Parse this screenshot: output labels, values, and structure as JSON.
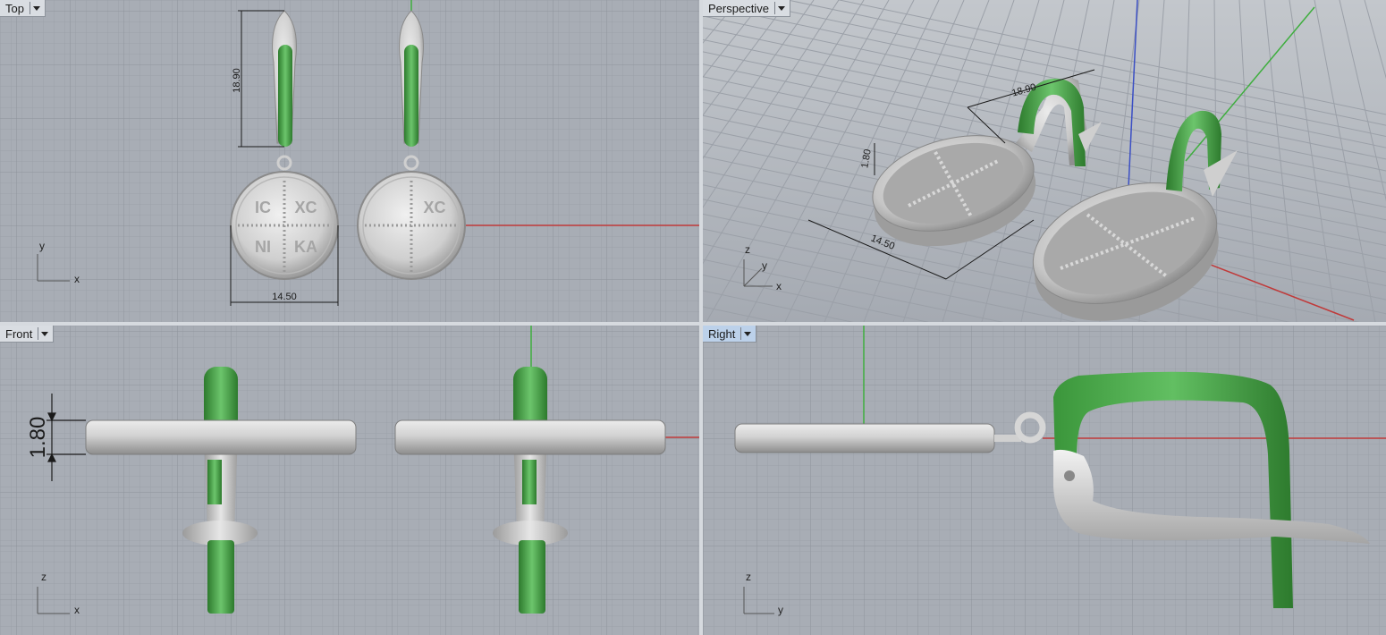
{
  "viewports": {
    "top": {
      "label": "Top",
      "dimensions": {
        "height": "18.90",
        "width": "14.50"
      },
      "medallion_left": {
        "tl": "IC",
        "tr": "XC",
        "bl": "NI",
        "br": "KA"
      },
      "medallion_right": {
        "tr": "XC"
      },
      "axes": {
        "v": "y",
        "h": "x"
      }
    },
    "perspective": {
      "label": "Perspective",
      "dimensions": {
        "height": "18.90",
        "width": "14.50",
        "thickness": "1.80"
      },
      "axes": {
        "v": "z",
        "d": "y",
        "h": "x"
      }
    },
    "front": {
      "label": "Front",
      "dimensions": {
        "thickness": "1.80"
      },
      "axes": {
        "v": "z",
        "h": "x"
      }
    },
    "right": {
      "label": "Right",
      "axes": {
        "v": "z",
        "h": "y"
      }
    }
  },
  "colors": {
    "grid_bg": "#a8adb5",
    "grid_minor": "#9ba1a9",
    "grid_major": "#8e949c",
    "x_axis": "#c03a3a",
    "y_axis": "#3fae3f",
    "z_axis": "#3b4fc4",
    "silver": "#d6d6d6",
    "green": "#3f9a3f"
  }
}
